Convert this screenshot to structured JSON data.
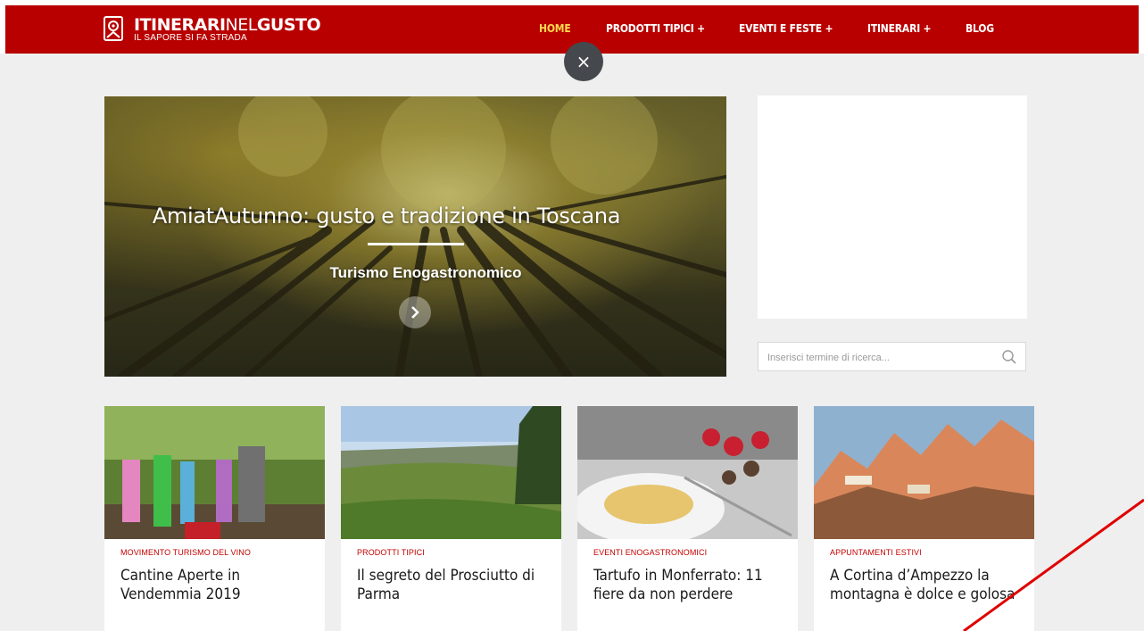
{
  "brand": {
    "title_bold1": "ITINERARI",
    "title_thin": "NEL",
    "title_bold2": "GUSTO",
    "tagline": "IL SAPORE SI FA STRADA",
    "color_nav": "#b80000",
    "color_accent": "#ffd84d"
  },
  "nav": {
    "items": [
      {
        "label": "HOME",
        "active": true
      },
      {
        "label": "PRODOTTI TIPICI +"
      },
      {
        "label": "EVENTI E FESTE +"
      },
      {
        "label": "ITINERARI +"
      },
      {
        "label": "BLOG"
      }
    ]
  },
  "overlay_close": {
    "icon": "close-icon",
    "glyph": "×"
  },
  "hero": {
    "title": "AmiatAutunno: gusto e tradizione in Toscana",
    "category": "Turismo Enogastronomico",
    "next_icon": "chevron-right-icon"
  },
  "sidebar": {
    "search_placeholder": "Inserisci termine di ricerca...",
    "search_icon": "search-icon"
  },
  "cards": [
    {
      "category": "MOVIMENTO TURISMO DEL VINO",
      "title": "Cantine Aperte in Vendemmia 2019"
    },
    {
      "category": "PRODOTTI TIPICI",
      "title": "Il segreto del Prosciutto di Parma"
    },
    {
      "category": "EVENTI ENOGASTRONOMICI",
      "title": "Tartufo in Monferrato: 11 fiere da non perdere"
    },
    {
      "category": "APPUNTAMENTI ESTIVI",
      "title": "A Cortina d’Ampezzo la montagna è dolce e golosa"
    }
  ]
}
